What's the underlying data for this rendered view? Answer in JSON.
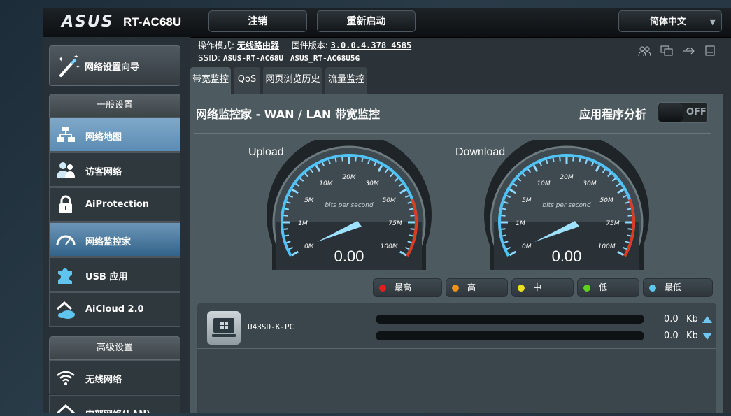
{
  "header": {
    "brand": "ASUS",
    "model": "RT-AC68U",
    "logout_label": "注销",
    "reboot_label": "重新启动",
    "language": "简体中文"
  },
  "info": {
    "mode_label": "操作模式:",
    "mode_value": "无线路由器",
    "fw_label": "固件版本:",
    "fw_value": "3.0.0.4.378_4585",
    "ssid_label": "SSID:",
    "ssid_1": "ASUS-RT-AC68U",
    "ssid_2": "ASUS_RT-AC68U5G"
  },
  "sidebar": {
    "wizard": "网络设置向导",
    "general_header": "一般设置",
    "general_items": [
      {
        "label": "网络地图",
        "icon": "network-map-icon"
      },
      {
        "label": "访客网络",
        "icon": "guest-network-icon"
      },
      {
        "label": "AiProtection",
        "icon": "lock-icon"
      },
      {
        "label": "网络监控家",
        "icon": "speedometer-icon"
      },
      {
        "label": "USB 应用",
        "icon": "puzzle-icon"
      },
      {
        "label": "AiCloud 2.0",
        "icon": "cloud-house-icon"
      }
    ],
    "advanced_header": "高级设置",
    "advanced_items": [
      {
        "label": "无线网络",
        "icon": "wifi-icon"
      },
      {
        "label": "内部网络(LAN)",
        "icon": "home-icon"
      }
    ]
  },
  "tabs": [
    "带宽监控",
    "QoS",
    "网页浏览历史",
    "流量监控"
  ],
  "panel": {
    "title": "网络监控家 - WAN / LAN 带宽监控",
    "app_analysis": "应用程序分析",
    "toggle": "OFF",
    "upload_label": "Upload",
    "download_label": "Download",
    "upload_value": "0.00",
    "download_value": "0.00",
    "gauge_unit": "bits per second",
    "gauge_ticks": [
      "0M",
      "1M",
      "5M",
      "10M",
      "20M",
      "30M",
      "50M",
      "75M",
      "100M"
    ]
  },
  "priorities": [
    {
      "label": "最高",
      "color": "#e02020"
    },
    {
      "label": "高",
      "color": "#f0901e"
    },
    {
      "label": "中",
      "color": "#e8e020"
    },
    {
      "label": "低",
      "color": "#5fd020"
    },
    {
      "label": "最低",
      "color": "#5cc8ee"
    }
  ],
  "client": {
    "name": "U43SD-K-PC",
    "upload_value": "0.0",
    "download_value": "0.0",
    "unit": "Kb"
  },
  "colors": {
    "accent_blue": "#5c8cb4",
    "gauge_arc": "#4fc3f7",
    "gauge_hot": "#e03a1e"
  }
}
